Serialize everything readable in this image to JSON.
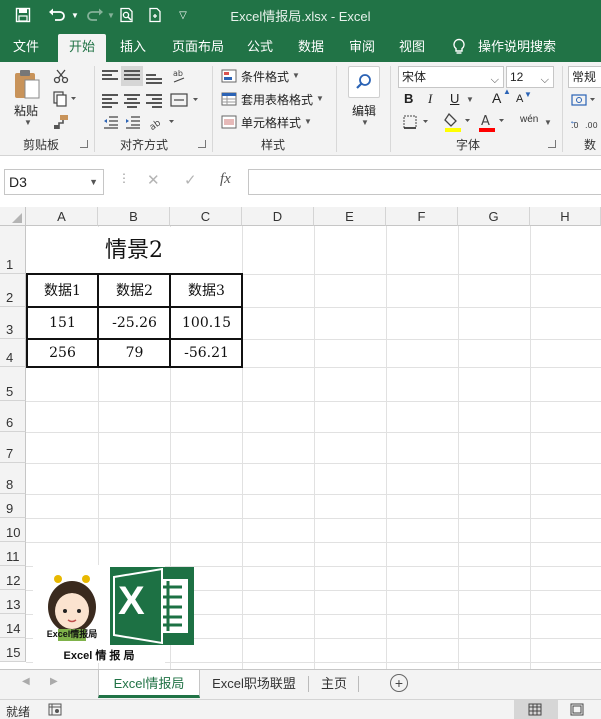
{
  "titlebar": {
    "title": "Excel情报局.xlsx  -  Excel",
    "save_icon": "save-icon",
    "undo_icon": "undo-icon",
    "redo_icon": "redo-icon",
    "print_preview_icon": "print-preview-icon",
    "new_icon": "new-file-icon",
    "customize_icon": "customize-qat-icon"
  },
  "tabs": [
    {
      "label": "文件"
    },
    {
      "label": "开始"
    },
    {
      "label": "插入"
    },
    {
      "label": "页面布局"
    },
    {
      "label": "公式"
    },
    {
      "label": "数据"
    },
    {
      "label": "审阅"
    },
    {
      "label": "视图"
    },
    {
      "label": "操作说明搜索"
    }
  ],
  "ribbon": {
    "clipboard": {
      "paste_label": "粘贴",
      "group_label": "剪贴板"
    },
    "alignment": {
      "group_label": "对齐方式"
    },
    "styles": {
      "conditional_format": "条件格式",
      "table_format": "套用表格格式",
      "cell_styles": "单元格样式",
      "group_label": "样式"
    },
    "editing": {
      "label": "编辑"
    },
    "font": {
      "font_name": "宋体",
      "font_size": "12",
      "bold": "B",
      "italic": "I",
      "underline": "U",
      "grow": "A",
      "shrink": "A",
      "phonetic": "wén",
      "group_label": "字体",
      "fill_color": "#ffff00",
      "font_color": "#ff0000"
    },
    "number": {
      "format": "常规",
      "group_label": "数"
    }
  },
  "formula_bar": {
    "name_box": "D3",
    "cancel_symbol": "✕",
    "enter_symbol": "✓",
    "fx_symbol": "fx",
    "value": ""
  },
  "sheet": {
    "columns": [
      "A",
      "B",
      "C",
      "D",
      "E",
      "F",
      "G",
      "H"
    ],
    "rows": [
      "1",
      "2",
      "3",
      "4",
      "5",
      "6",
      "7",
      "8",
      "9",
      "10",
      "11",
      "12",
      "13",
      "14",
      "15"
    ],
    "title": "情景2",
    "table": {
      "headers": [
        "数据1",
        "数据2",
        "数据3"
      ],
      "rows": [
        [
          "151",
          "-25.26",
          "100.15"
        ],
        [
          "256",
          "79",
          "-56.21"
        ]
      ]
    },
    "logo": {
      "cartoon_caption": "Excel情报局",
      "caption": "Excel 情 报 局",
      "excel_letter": "X"
    }
  },
  "sheet_tabs": [
    {
      "label": "Excel情报局",
      "active": true
    },
    {
      "label": "Excel职场联盟",
      "active": false
    },
    {
      "label": "主页",
      "active": false
    }
  ],
  "status": {
    "ready": "就绪"
  },
  "colors": {
    "accent": "#217346"
  }
}
